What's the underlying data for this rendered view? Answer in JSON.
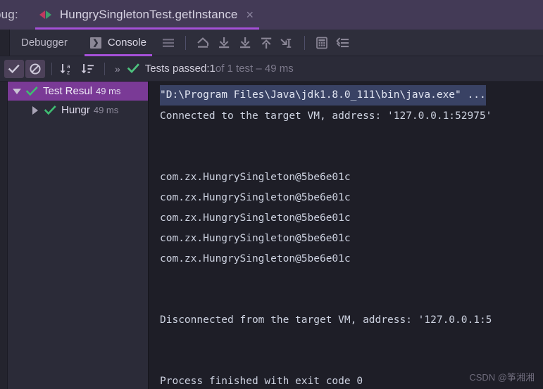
{
  "tabbar": {
    "window_label": "bug:",
    "tab_title": "HungrySingletonTest.getInstance",
    "close_glyph": "×",
    "debug_icon_name": "debug-step-icon",
    "accent_color": "#a550d8",
    "background_color": "#433a56"
  },
  "subbar": {
    "tabs": [
      {
        "label": "Debugger",
        "active": false
      },
      {
        "label": "Console",
        "active": true,
        "icon": "console-icon",
        "icon_glyph": "❯"
      }
    ],
    "buttons": [
      {
        "name": "soft-wrap-icon"
      },
      {
        "name": "step-out-icon"
      },
      {
        "name": "step-over-icon"
      },
      {
        "name": "step-into-icon"
      },
      {
        "name": "force-step-into-icon"
      },
      {
        "name": "run-to-cursor-icon"
      },
      {
        "name": "evaluate-expression-icon"
      },
      {
        "name": "settings-filter-icon"
      }
    ]
  },
  "runbar": {
    "buttons": [
      {
        "name": "show-passed-toggle",
        "toggled": true,
        "icon": "check-icon"
      },
      {
        "name": "show-ignored-toggle",
        "toggled": true,
        "icon": "no-entry-icon"
      },
      {
        "name": "sort-alphabetically-button",
        "toggled": false,
        "icon": "sort-alpha-icon"
      },
      {
        "name": "sort-by-duration-button",
        "toggled": false,
        "icon": "sort-duration-icon"
      }
    ],
    "more_glyph": "»",
    "status": {
      "prefix": "Tests passed: ",
      "count": "1",
      "suffix": " of 1 test – 49 ms",
      "passed_color": "#4ec27e"
    }
  },
  "tree": {
    "rows": [
      {
        "label": "Test Resul",
        "time": "49 ms",
        "expanded": true,
        "selected": true,
        "indent": false,
        "status": "passed"
      },
      {
        "label": "Hungr",
        "time": "49 ms",
        "expanded": false,
        "selected": false,
        "indent": true,
        "status": "passed"
      }
    ],
    "selection_color": "#7a3a96"
  },
  "console": {
    "background_color": "#1e1e27",
    "selection_color": "#394264",
    "lines": [
      {
        "text": "\"D:\\Program Files\\Java\\jdk1.8.0_111\\bin\\java.exe\" ...",
        "selected": true
      },
      {
        "text": "Connected to the target VM, address: '127.0.0.1:52975'",
        "selected": false
      },
      {
        "text": "",
        "selected": false
      },
      {
        "text": "",
        "selected": false
      },
      {
        "text": "com.zx.HungrySingleton@5be6e01c",
        "selected": false
      },
      {
        "text": "com.zx.HungrySingleton@5be6e01c",
        "selected": false
      },
      {
        "text": "com.zx.HungrySingleton@5be6e01c",
        "selected": false
      },
      {
        "text": "com.zx.HungrySingleton@5be6e01c",
        "selected": false
      },
      {
        "text": "com.zx.HungrySingleton@5be6e01c",
        "selected": false
      },
      {
        "text": "",
        "selected": false
      },
      {
        "text": "",
        "selected": false
      },
      {
        "text": "Disconnected from the target VM, address: '127.0.0.1:5",
        "selected": false
      },
      {
        "text": "",
        "selected": false
      },
      {
        "text": "",
        "selected": false
      },
      {
        "text": "Process finished with exit code 0",
        "selected": false
      }
    ]
  },
  "watermark": {
    "text": "CSDN @筝湘湘"
  }
}
